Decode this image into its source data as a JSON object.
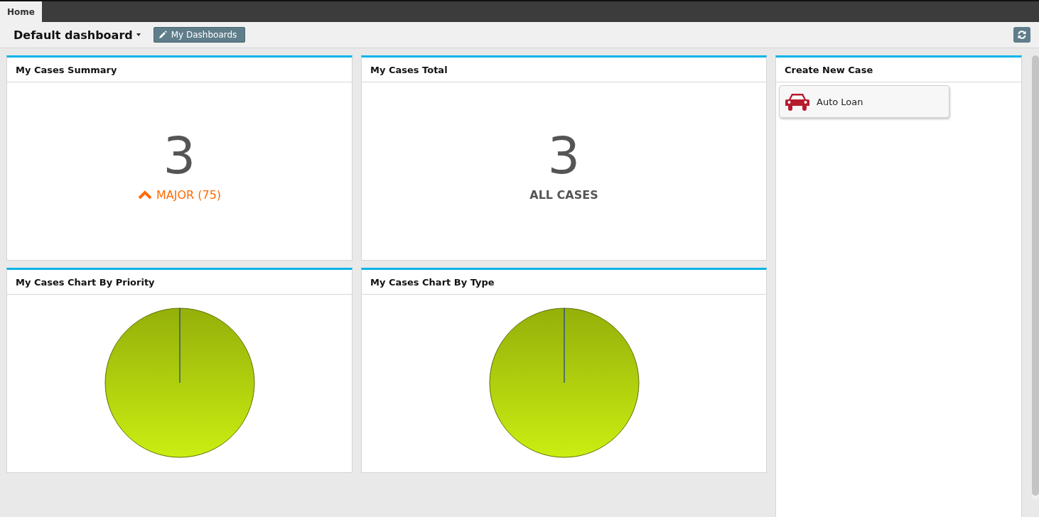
{
  "tabs": [
    {
      "label": "Home",
      "selected": true
    }
  ],
  "toolbar": {
    "dashboard_title": "Default dashboard",
    "my_dashboards_button": "My Dashboards"
  },
  "widgets": [
    {
      "kind": "summary",
      "title": "My Cases Summary",
      "count": "3",
      "priority_label": "MAJOR (75)"
    },
    {
      "kind": "total",
      "title": "My Cases Total",
      "count": "3",
      "caption": "ALL CASES"
    },
    {
      "kind": "pie",
      "title": "My Cases Chart By Priority"
    },
    {
      "kind": "pie",
      "title": "My Cases Chart By Type"
    }
  ],
  "create_new_case": {
    "title": "Create New Case",
    "items": [
      {
        "label": "Auto Loan"
      }
    ]
  }
}
